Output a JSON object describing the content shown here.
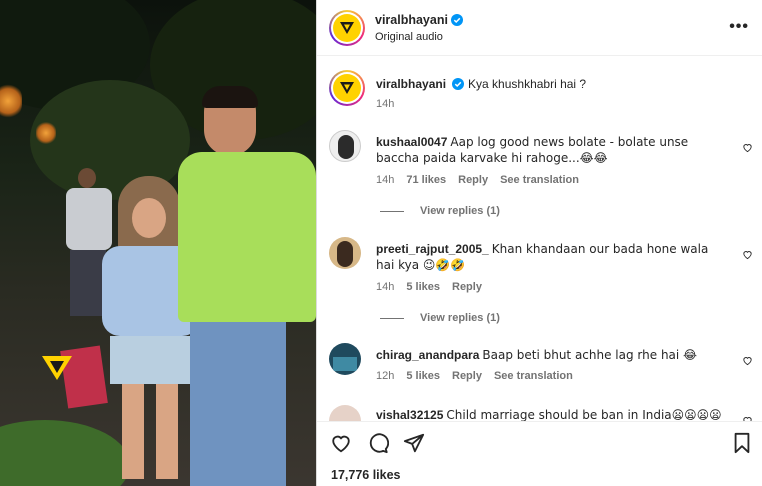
{
  "post": {
    "username": "viralbhayani",
    "audio": "Original audio",
    "more_label": "•••",
    "caption": "Kya khushkhabri hai ?",
    "caption_time": "14h"
  },
  "comments": [
    {
      "username": "kushaal0047",
      "text": "Aap log good news bolate - bolate unse baccha paida karvake hi rahoge...😂😂",
      "time": "14h",
      "likes": "71 likes",
      "reply": "Reply",
      "translate": "See translation",
      "view_replies": "View replies (1)"
    },
    {
      "username": "preeti_rajput_2005_",
      "text": "Khan khandaan our bada hone wala hai kya 😉🤣🤣",
      "time": "14h",
      "likes": "5 likes",
      "reply": "Reply",
      "view_replies": "View replies (1)"
    },
    {
      "username": "chirag_anandpara",
      "text": "Baap beti bhut achhe lag rhe hai 😂",
      "time": "12h",
      "likes": "5 likes",
      "reply": "Reply",
      "translate": "See translation"
    },
    {
      "username": "vishal32125",
      "text": "Child marriage should be ban in India😦😦😦😦"
    }
  ],
  "footer": {
    "likes": "17,776 likes"
  },
  "icons": {
    "like": "heart-icon",
    "comment": "comment-icon",
    "share": "share-icon",
    "save": "bookmark-icon",
    "verified": "verified-badge-icon"
  },
  "colors": {
    "verified": "#0095f6",
    "brand_yellow": "#ffd200",
    "meta_gray": "#737373"
  }
}
